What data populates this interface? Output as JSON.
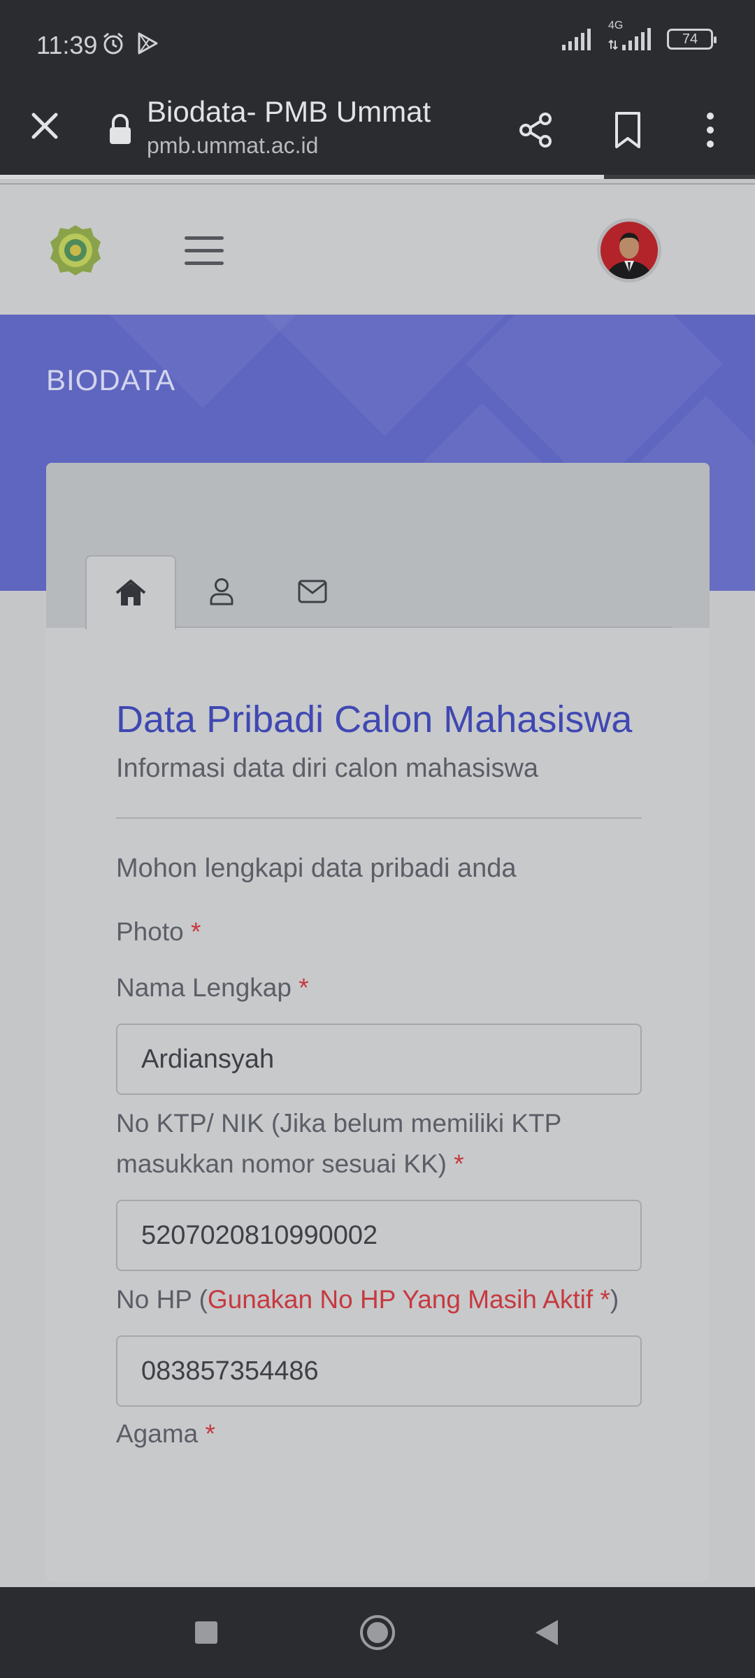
{
  "status_bar": {
    "time": "11:39",
    "network": "4G",
    "battery": "74",
    "icons": [
      "alarm-icon",
      "play-store-icon",
      "signal-icon",
      "battery-icon"
    ]
  },
  "browser": {
    "title": "Biodata- PMB Ummat",
    "url": "pmb.ummat.ac.id",
    "load_progress": 0.8
  },
  "banner": {
    "title": "BIODATA"
  },
  "tabs": [
    "home-icon",
    "user-icon",
    "envelope-icon"
  ],
  "form": {
    "title": "Data Pribadi Calon Mahasiswa",
    "subtitle": "Informasi data diri calon mahasiswa",
    "hint": "Mohon lengkapi data pribadi anda",
    "photo_label": "Photo",
    "name_label": "Nama Lengkap",
    "name_value": "Ardiansyah",
    "nik_label": "No KTP/ NIK (Jika belum memiliki KTP masukkan nomor sesuai KK)",
    "nik_value": "5207020810990002",
    "hp_label_prefix": "No HP (",
    "hp_label_warning": "Gunakan No HP Yang Masih Aktif",
    "hp_label_suffix": ")",
    "hp_value": "083857354486",
    "religion_label": "Agama",
    "required_mark": "*"
  },
  "colors": {
    "accent": "#3f48b2",
    "banner": "#5f66bf",
    "required": "#c6393f",
    "system_bar": "#2b2c30"
  }
}
